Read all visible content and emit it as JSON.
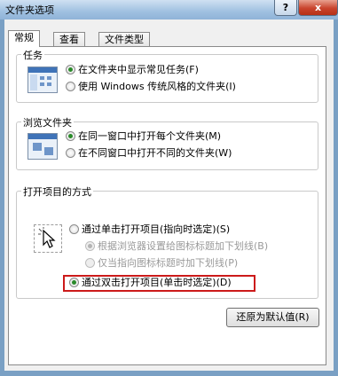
{
  "window": {
    "title": "文件夹选项",
    "help_label": "?",
    "close_label": "x"
  },
  "tabs": [
    {
      "label": "常规",
      "active": true
    },
    {
      "label": "查看",
      "active": false
    },
    {
      "label": "文件类型",
      "active": false
    }
  ],
  "tasks_group": {
    "title": "任务",
    "icon": "folder-tasks-icon",
    "options": [
      {
        "label": "在文件夹中显示常见任务(F)",
        "checked": true
      },
      {
        "label": "使用 Windows 传统风格的文件夹(I)",
        "checked": false
      }
    ]
  },
  "browse_group": {
    "title": "浏览文件夹",
    "icon": "folder-window-icon",
    "options": [
      {
        "label": "在同一窗口中打开每个文件夹(M)",
        "checked": true
      },
      {
        "label": "在不同窗口中打开不同的文件夹(W)",
        "checked": false
      }
    ]
  },
  "open_group": {
    "title": "打开项目的方式",
    "icon": "pointer-cursor-icon",
    "options": [
      {
        "label": "通过单击打开项目(指向时选定)(S)",
        "checked": false,
        "enabled": true
      },
      {
        "label": "根据浏览器设置给图标标题加下划线(B)",
        "checked": true,
        "enabled": false
      },
      {
        "label": "仅当指向图标标题时加下划线(P)",
        "checked": false,
        "enabled": false
      },
      {
        "label": "通过双击打开项目(单击时选定)(D)",
        "checked": true,
        "enabled": true
      }
    ],
    "highlight_color": "#cc1a1a"
  },
  "restore_button": "还原为默认值(R)"
}
